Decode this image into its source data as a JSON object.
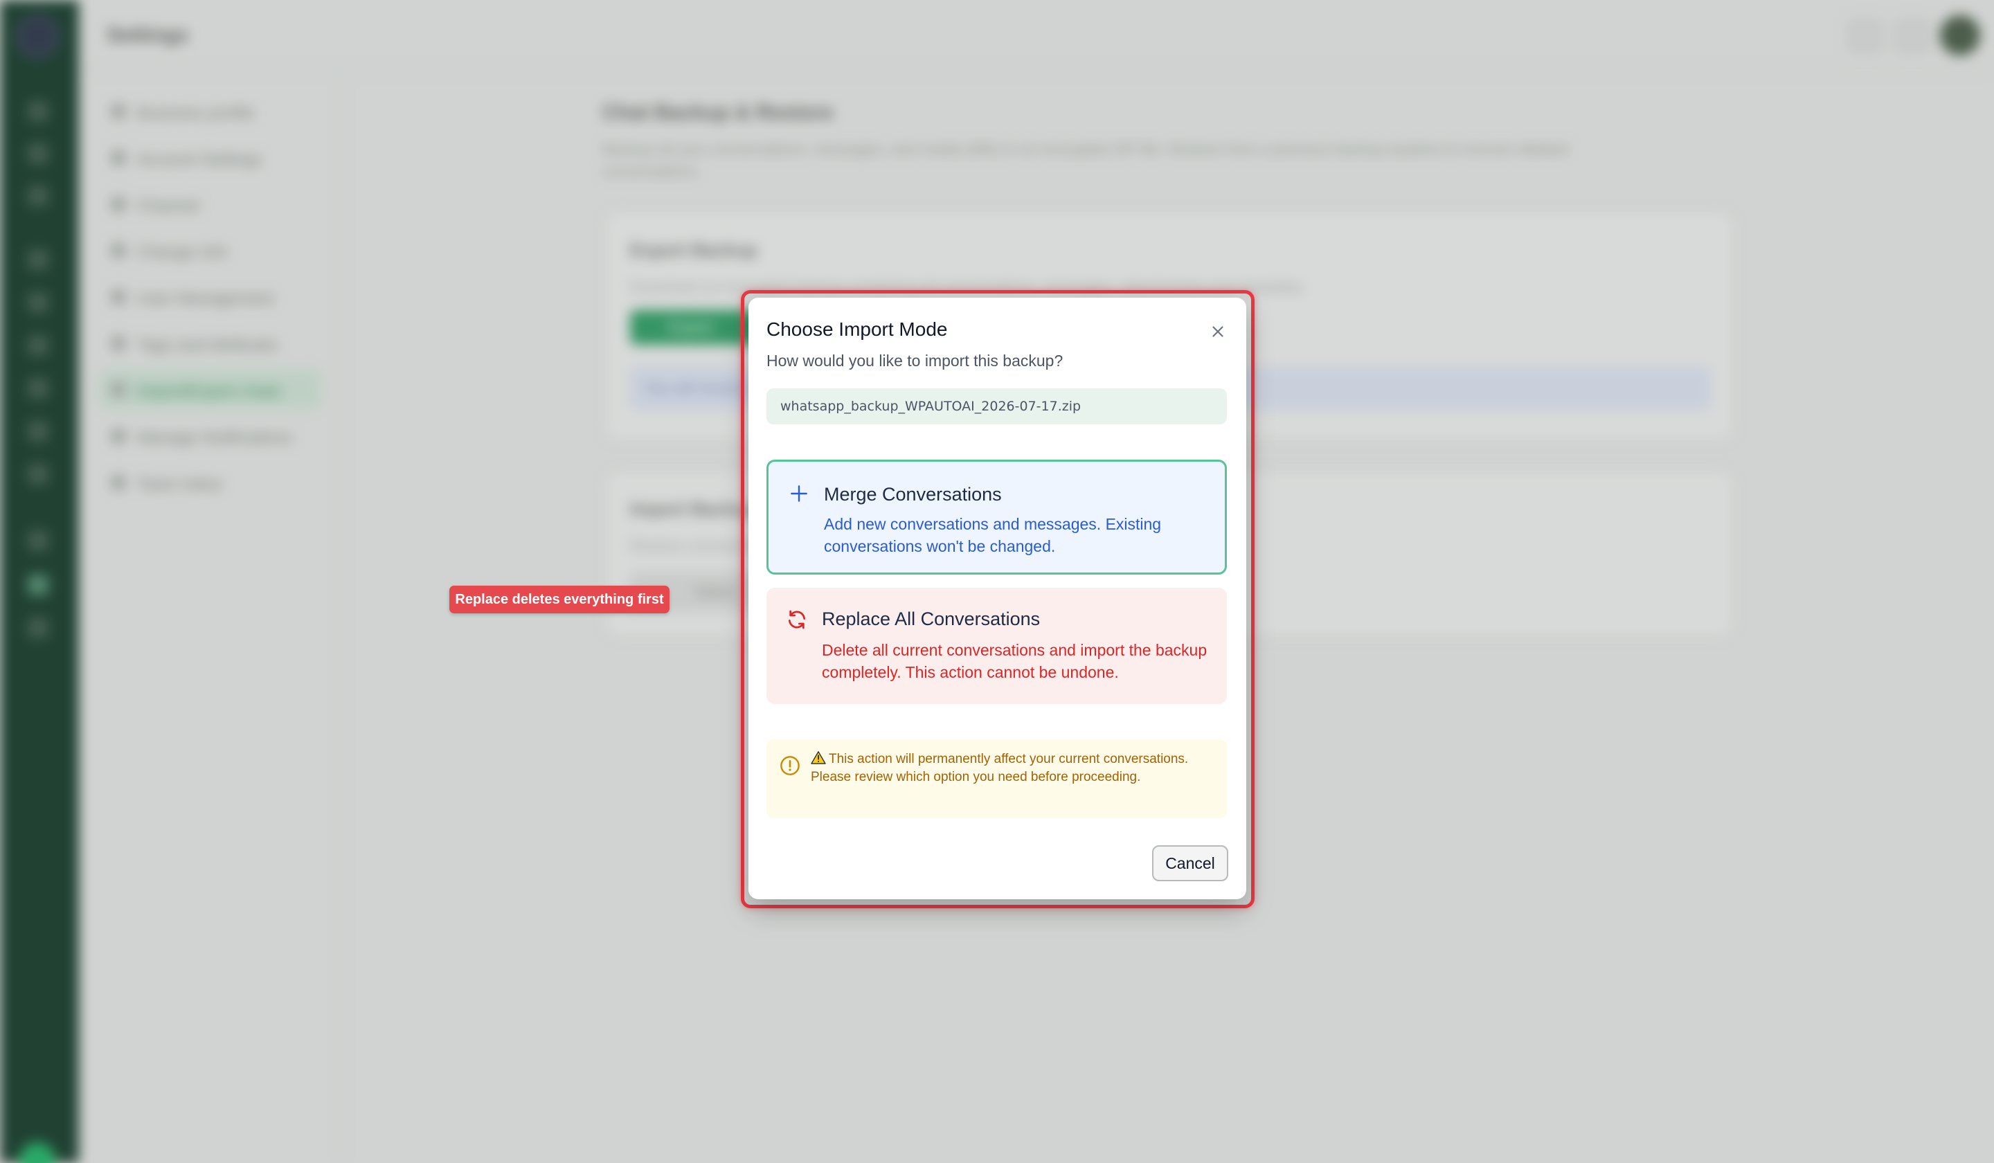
{
  "header": {
    "title": "Settings"
  },
  "settings_nav": {
    "items": [
      {
        "label": "Business profile"
      },
      {
        "label": "Account Settings"
      },
      {
        "label": "Channel"
      },
      {
        "label": "Change Info"
      },
      {
        "label": "User Management"
      },
      {
        "label": "Tags and Attributes"
      },
      {
        "label": "Import/Export chats",
        "active": true
      },
      {
        "label": "Manage Notifications"
      },
      {
        "label": "Team Inbox"
      }
    ]
  },
  "page": {
    "title": "Chat Backup & Restore",
    "description": "Backup all your conversations, messages, and media (tiffs) in an encrypted ZIP file. Restore from a previous backup anytime to recover deleted conversations."
  },
  "export_card": {
    "title": "Export Backup",
    "description": "Download an encrypted backup containing all conversations, messages, attachments and metadata.",
    "button_label": "Export",
    "info_text": "You will receive"
  },
  "import_card": {
    "title": "Import Backup",
    "description": "Restore conversations",
    "select_label": "Select"
  },
  "hint_tag": {
    "label": "Replace deletes everything first"
  },
  "dialog": {
    "title": "Choose Import Mode",
    "subtitle": "How would you like to import this backup?",
    "file_name": "whatsapp_backup_WPAUTOAI_2026-07-17.zip",
    "options": {
      "merge": {
        "title": "Merge Conversations",
        "description": "Add new conversations and messages. Existing conversations won't be changed.",
        "icon": "plus-icon"
      },
      "replace": {
        "title": "Replace All Conversations",
        "description": "Delete all current conversations and import the backup completely. This action cannot be undone.",
        "icon": "refresh-icon"
      }
    },
    "warning": "This action will permanently affect your current conversations. Please review which option you need before proceeding.",
    "cancel_label": "Cancel"
  },
  "colors": {
    "brand_dark": "#153a2a",
    "accent_green": "#57c493",
    "merge_blue": "#2a5bd7",
    "danger_red": "#dc2626",
    "highlight_red": "#e93a44",
    "warning_amber": "#a16207"
  }
}
